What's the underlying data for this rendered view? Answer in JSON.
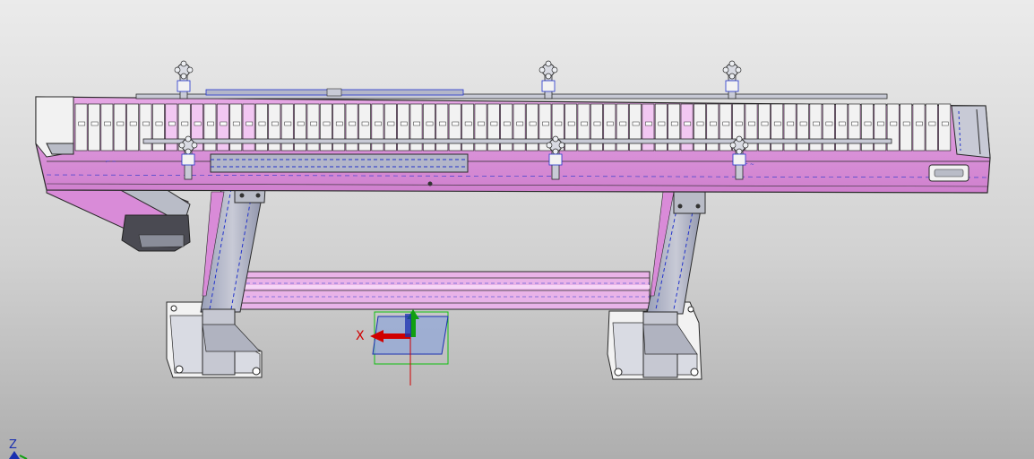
{
  "viewport": {
    "background_top": "#ebebeb",
    "background_bottom": "#aeaeae",
    "model_color": "#d98bd8",
    "model_highlight": "#f2c7f2",
    "edge_color": "#2a2a2a",
    "hidden_edge_color": "#2233cc",
    "metal_color": "#b9bcc7",
    "white_part_color": "#f2f2f2"
  },
  "triad": {
    "x_label": "X",
    "x_color": "#d00000",
    "y_color": "#10a010",
    "z_color": "#1a2fb0",
    "plane_color": "#8ea5d8"
  },
  "view_orientation": {
    "z_label": "Z",
    "z_color": "#1a2fb0"
  },
  "conveyor": {
    "slat_count": 68,
    "highlighted_slats": [
      7,
      9,
      11,
      13,
      44,
      47
    ]
  }
}
